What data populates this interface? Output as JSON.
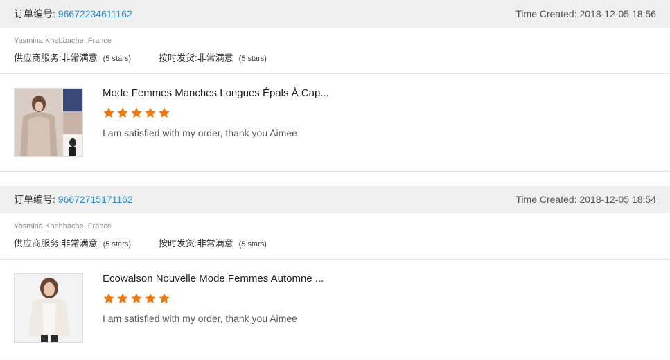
{
  "accent_color": "#2b8acb",
  "star_color": "#f07a10",
  "orders": [
    {
      "order_label": "订单编号:",
      "order_number": "96672234611162",
      "time_created": "Time Created: 2018-12-05 18:56",
      "buyer": "Yasmina Khebbache ,France",
      "supplier_service_label": "供应商服务:",
      "supplier_service_value": "非常满意",
      "supplier_service_stars": "(5 stars)",
      "on_time_label": "按时发货:",
      "on_time_value": "非常满意",
      "on_time_stars": "(5 stars)",
      "product_title": "Mode Femmes Manches Longues Épals À Cap...",
      "rating": 5,
      "comment": "I am satisfied with my order, thank you Aimee",
      "thumbnail_icon": "product-photo-collage"
    },
    {
      "order_label": "订单编号:",
      "order_number": "96672715171162",
      "time_created": "Time Created: 2018-12-05 18:54",
      "buyer": "Yasmina Khebbache ,France",
      "supplier_service_label": "供应商服务:",
      "supplier_service_value": "非常满意",
      "supplier_service_stars": "(5 stars)",
      "on_time_label": "按时发货:",
      "on_time_value": "非常满意",
      "on_time_stars": "(5 stars)",
      "product_title": "Ecowalson Nouvelle Mode Femmes Automne ...",
      "rating": 5,
      "comment": "I am satisfied with my order, thank you Aimee",
      "thumbnail_icon": "product-photo-model"
    }
  ]
}
